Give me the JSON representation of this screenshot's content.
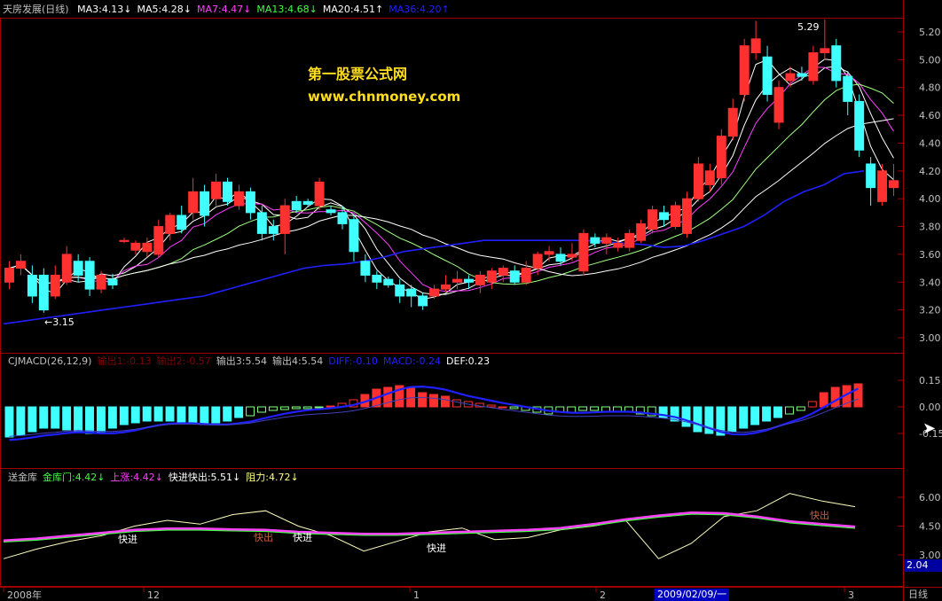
{
  "window": {
    "stock_name": "天房发展",
    "period": "(日线)",
    "period_button": "日线",
    "date_cursor": "2009/02/09/一"
  },
  "watermark": {
    "line1": "第一股票公式网",
    "line2": "www.chnmoney.com"
  },
  "main_panel": {
    "legend": [
      {
        "text": "MA3:4.13",
        "arrow": "↓",
        "color": "#ffffff"
      },
      {
        "text": "MA5:4.28",
        "arrow": "↓",
        "color": "#ffffff"
      },
      {
        "text": "MA7:4.47",
        "arrow": "↓",
        "color": "#ff40ff"
      },
      {
        "text": "MA13:4.68",
        "arrow": "↓",
        "color": "#40ff40"
      },
      {
        "text": "MA20:4.51",
        "arrow": "↑",
        "color": "#ffffff"
      },
      {
        "text": "MA36:4.20",
        "arrow": "↑",
        "color": "#2020ff"
      }
    ],
    "y_ticks": [
      "5.20",
      "5.00",
      "4.80",
      "4.60",
      "4.40",
      "4.20",
      "4.00",
      "3.80",
      "3.60",
      "3.40",
      "3.20",
      "3.00"
    ],
    "high_label": "5.29",
    "low_label": "3.15"
  },
  "macd_panel": {
    "legend": [
      {
        "text": "CJMACD(26,12,9)",
        "color": "#c0c0c0"
      },
      {
        "text": "输出1:-0.13",
        "color": "#800000"
      },
      {
        "text": "输出2:-0.57",
        "color": "#800000"
      },
      {
        "text": "输出3:5.54",
        "color": "#c0c0c0"
      },
      {
        "text": "输出4:5.54",
        "color": "#c0c0c0"
      },
      {
        "text": "DIFF:-0.10",
        "color": "#2020ff"
      },
      {
        "text": "MACD:-0.24",
        "color": "#2020ff"
      },
      {
        "text": "DEF:0.23",
        "color": "#ffffff"
      }
    ],
    "y_ticks": [
      "0.15",
      "0.00",
      "-0.15"
    ]
  },
  "lower_panel": {
    "legend": [
      {
        "text": "送金库",
        "color": "#c0c0c0"
      },
      {
        "text": "金库门:4.42",
        "arrow": "↓",
        "color": "#40ff40"
      },
      {
        "text": "上涨:4.42",
        "arrow": "↓",
        "color": "#ff40ff"
      },
      {
        "text": "快进快出:5.51",
        "arrow": "↓",
        "color": "#ffffff"
      },
      {
        "text": "阻力:4.72",
        "arrow": "↓",
        "color": "#ffff80"
      }
    ],
    "y_ticks": [
      "6.00",
      "4.50",
      "3.00"
    ],
    "current_value": "2.04",
    "signals": [
      "快进",
      "快出",
      "快进",
      "快进",
      "快出"
    ]
  },
  "x_axis": {
    "labels": [
      "2008年",
      "12",
      "1",
      "2",
      "3"
    ]
  },
  "chart_data": {
    "type": "candlestick",
    "title": "天房发展(日线)",
    "ylim": [
      2.9,
      5.3
    ],
    "candles": [
      {
        "o": 3.4,
        "c": 3.5,
        "h": 3.55,
        "l": 3.35
      },
      {
        "o": 3.5,
        "c": 3.55,
        "h": 3.6,
        "l": 3.45
      },
      {
        "o": 3.45,
        "c": 3.3,
        "h": 3.52,
        "l": 3.25
      },
      {
        "o": 3.45,
        "c": 3.2,
        "h": 3.5,
        "l": 3.18
      },
      {
        "o": 3.3,
        "c": 3.45,
        "h": 3.52,
        "l": 3.28
      },
      {
        "o": 3.4,
        "c": 3.6,
        "h": 3.66,
        "l": 3.38
      },
      {
        "o": 3.55,
        "c": 3.45,
        "h": 3.6,
        "l": 3.4
      },
      {
        "o": 3.55,
        "c": 3.35,
        "h": 3.58,
        "l": 3.3
      },
      {
        "o": 3.35,
        "c": 3.45,
        "h": 3.48,
        "l": 3.32
      },
      {
        "o": 3.42,
        "c": 3.38,
        "h": 3.46,
        "l": 3.35
      },
      {
        "o": 3.7,
        "c": 3.7,
        "h": 3.72,
        "l": 3.68
      },
      {
        "o": 3.63,
        "c": 3.68,
        "h": 3.7,
        "l": 3.6
      },
      {
        "o": 3.62,
        "c": 3.68,
        "h": 3.72,
        "l": 3.58
      },
      {
        "o": 3.6,
        "c": 3.8,
        "h": 3.85,
        "l": 3.58
      },
      {
        "o": 3.75,
        "c": 3.88,
        "h": 3.9,
        "l": 3.7
      },
      {
        "o": 3.88,
        "c": 3.78,
        "h": 3.95,
        "l": 3.75
      },
      {
        "o": 3.9,
        "c": 4.05,
        "h": 4.15,
        "l": 3.85
      },
      {
        "o": 4.05,
        "c": 3.88,
        "h": 4.1,
        "l": 3.8
      },
      {
        "o": 4.0,
        "c": 4.12,
        "h": 4.18,
        "l": 3.95
      },
      {
        "o": 4.12,
        "c": 3.98,
        "h": 4.15,
        "l": 3.95
      },
      {
        "o": 3.95,
        "c": 4.05,
        "h": 4.1,
        "l": 3.92
      },
      {
        "o": 4.05,
        "c": 3.9,
        "h": 4.08,
        "l": 3.85
      },
      {
        "o": 3.9,
        "c": 3.75,
        "h": 3.95,
        "l": 3.7
      },
      {
        "o": 3.8,
        "c": 3.75,
        "h": 3.85,
        "l": 3.7
      },
      {
        "o": 3.75,
        "c": 3.95,
        "h": 4.0,
        "l": 3.6
      },
      {
        "o": 3.98,
        "c": 3.92,
        "h": 4.02,
        "l": 3.9
      },
      {
        "o": 3.98,
        "c": 3.96,
        "h": 4.0,
        "l": 3.94
      },
      {
        "o": 3.95,
        "c": 4.12,
        "h": 4.15,
        "l": 3.92
      },
      {
        "o": 3.92,
        "c": 3.9,
        "h": 3.95,
        "l": 3.88
      },
      {
        "o": 3.9,
        "c": 3.82,
        "h": 3.95,
        "l": 3.78
      },
      {
        "o": 3.85,
        "c": 3.62,
        "h": 3.88,
        "l": 3.55
      },
      {
        "o": 3.55,
        "c": 3.45,
        "h": 3.6,
        "l": 3.4
      },
      {
        "o": 3.45,
        "c": 3.4,
        "h": 3.48,
        "l": 3.35
      },
      {
        "o": 3.42,
        "c": 3.38,
        "h": 3.44,
        "l": 3.36
      },
      {
        "o": 3.38,
        "c": 3.3,
        "h": 3.42,
        "l": 3.25
      },
      {
        "o": 3.35,
        "c": 3.3,
        "h": 3.38,
        "l": 3.22
      },
      {
        "o": 3.3,
        "c": 3.23,
        "h": 3.32,
        "l": 3.2
      },
      {
        "o": 3.3,
        "c": 3.35,
        "h": 3.38,
        "l": 3.28
      },
      {
        "o": 3.35,
        "c": 3.38,
        "h": 3.45,
        "l": 3.33
      },
      {
        "o": 3.4,
        "c": 3.42,
        "h": 3.48,
        "l": 3.35
      },
      {
        "o": 3.42,
        "c": 3.4,
        "h": 3.45,
        "l": 3.35
      },
      {
        "o": 3.38,
        "c": 3.45,
        "h": 3.48,
        "l": 3.32
      },
      {
        "o": 3.4,
        "c": 3.48,
        "h": 3.5,
        "l": 3.35
      },
      {
        "o": 3.45,
        "c": 3.5,
        "h": 3.52,
        "l": 3.4
      },
      {
        "o": 3.48,
        "c": 3.4,
        "h": 3.52,
        "l": 3.38
      },
      {
        "o": 3.4,
        "c": 3.5,
        "h": 3.55,
        "l": 3.38
      },
      {
        "o": 3.5,
        "c": 3.6,
        "h": 3.62,
        "l": 3.45
      },
      {
        "o": 3.6,
        "c": 3.62,
        "h": 3.66,
        "l": 3.55
      },
      {
        "o": 3.6,
        "c": 3.55,
        "h": 3.65,
        "l": 3.52
      },
      {
        "o": 3.58,
        "c": 3.6,
        "h": 3.68,
        "l": 3.55
      },
      {
        "o": 3.48,
        "c": 3.75,
        "h": 3.78,
        "l": 3.45
      },
      {
        "o": 3.72,
        "c": 3.68,
        "h": 3.75,
        "l": 3.65
      },
      {
        "o": 3.68,
        "c": 3.72,
        "h": 3.75,
        "l": 3.6
      },
      {
        "o": 3.65,
        "c": 3.68,
        "h": 3.72,
        "l": 3.62
      },
      {
        "o": 3.65,
        "c": 3.75,
        "h": 3.78,
        "l": 3.62
      },
      {
        "o": 3.7,
        "c": 3.82,
        "h": 3.85,
        "l": 3.68
      },
      {
        "o": 3.78,
        "c": 3.92,
        "h": 3.95,
        "l": 3.75
      },
      {
        "o": 3.9,
        "c": 3.85,
        "h": 3.95,
        "l": 3.8
      },
      {
        "o": 3.8,
        "c": 3.95,
        "h": 3.98,
        "l": 3.78
      },
      {
        "o": 3.75,
        "c": 4.0,
        "h": 4.05,
        "l": 3.72
      },
      {
        "o": 4.0,
        "c": 4.25,
        "h": 4.3,
        "l": 3.98
      },
      {
        "o": 4.1,
        "c": 4.2,
        "h": 4.25,
        "l": 4.05
      },
      {
        "o": 4.15,
        "c": 4.45,
        "h": 4.5,
        "l": 4.1
      },
      {
        "o": 4.45,
        "c": 4.65,
        "h": 4.72,
        "l": 4.42
      },
      {
        "o": 4.75,
        "c": 5.1,
        "h": 5.15,
        "l": 4.7
      },
      {
        "o": 5.05,
        "c": 5.15,
        "h": 5.28,
        "l": 5.0
      },
      {
        "o": 5.02,
        "c": 4.75,
        "h": 5.1,
        "l": 4.7
      },
      {
        "o": 4.55,
        "c": 4.8,
        "h": 4.85,
        "l": 4.5
      },
      {
        "o": 4.85,
        "c": 4.9,
        "h": 4.95,
        "l": 4.8
      },
      {
        "o": 4.9,
        "c": 4.88,
        "h": 4.95,
        "l": 4.85
      },
      {
        "o": 4.85,
        "c": 5.05,
        "h": 5.1,
        "l": 4.82
      },
      {
        "o": 5.05,
        "c": 5.08,
        "h": 5.29,
        "l": 5.0
      },
      {
        "o": 5.1,
        "c": 4.85,
        "h": 5.15,
        "l": 4.8
      },
      {
        "o": 4.88,
        "c": 4.7,
        "h": 4.92,
        "l": 4.6
      },
      {
        "o": 4.7,
        "c": 4.35,
        "h": 4.75,
        "l": 4.3
      },
      {
        "o": 4.25,
        "c": 4.08,
        "h": 4.3,
        "l": 3.95
      },
      {
        "o": 3.98,
        "c": 4.2,
        "h": 4.25,
        "l": 3.95
      },
      {
        "o": 4.08,
        "c": 4.13,
        "h": 4.25,
        "l": 4.02
      }
    ],
    "macd_bars": [
      -0.17,
      -0.16,
      -0.14,
      -0.12,
      -0.12,
      -0.13,
      -0.14,
      -0.15,
      -0.14,
      -0.12,
      -0.1,
      -0.09,
      -0.08,
      -0.08,
      -0.08,
      -0.09,
      -0.09,
      -0.1,
      -0.09,
      -0.08,
      -0.06,
      -0.05,
      -0.03,
      -0.02,
      -0.015,
      -0.01,
      -0.01,
      -0.005,
      0.005,
      0.02,
      0.04,
      0.07,
      0.1,
      0.11,
      0.12,
      0.11,
      0.08,
      0.07,
      0.06,
      0.04,
      0.03,
      0.02,
      0.01,
      0.0,
      -0.01,
      -0.02,
      -0.03,
      -0.04,
      -0.03,
      -0.03,
      -0.02,
      -0.02,
      -0.025,
      -0.03,
      -0.03,
      -0.04,
      -0.05,
      -0.06,
      -0.08,
      -0.11,
      -0.14,
      -0.15,
      -0.16,
      -0.14,
      -0.12,
      -0.1,
      -0.08,
      -0.06,
      -0.04,
      -0.02,
      0.03,
      0.08,
      0.11,
      0.12,
      0.13
    ],
    "ma36": [
      3.1,
      3.12,
      3.14,
      3.16,
      3.18,
      3.2,
      3.22,
      3.24,
      3.26,
      3.28,
      3.3,
      3.34,
      3.38,
      3.42,
      3.46,
      3.5,
      3.52,
      3.53,
      3.55,
      3.58,
      3.62,
      3.64,
      3.66,
      3.68,
      3.7,
      3.7,
      3.7,
      3.7,
      3.7,
      3.7,
      3.69,
      3.68,
      3.67,
      3.65,
      3.66,
      3.7,
      3.75,
      3.8,
      3.88,
      3.98,
      4.05,
      4.1,
      4.18,
      4.2
    ],
    "jinkumen": [
      3.7,
      3.8,
      3.95,
      4.1,
      4.25,
      4.32,
      4.32,
      4.28,
      4.25,
      4.15,
      4.1,
      4.05,
      4.05,
      4.1,
      4.15,
      4.2,
      4.25,
      4.35,
      4.55,
      4.8,
      5.0,
      5.15,
      5.12,
      4.95,
      4.7,
      4.55,
      4.42
    ],
    "kuaijin": [
      2.8,
      3.3,
      3.7,
      4.0,
      4.5,
      4.8,
      4.6,
      5.1,
      5.3,
      4.5,
      4.0,
      3.2,
      3.7,
      4.2,
      4.4,
      3.8,
      3.9,
      4.3,
      4.5,
      4.8,
      2.8,
      3.6,
      5.0,
      5.3,
      6.2,
      5.8,
      5.51
    ]
  }
}
